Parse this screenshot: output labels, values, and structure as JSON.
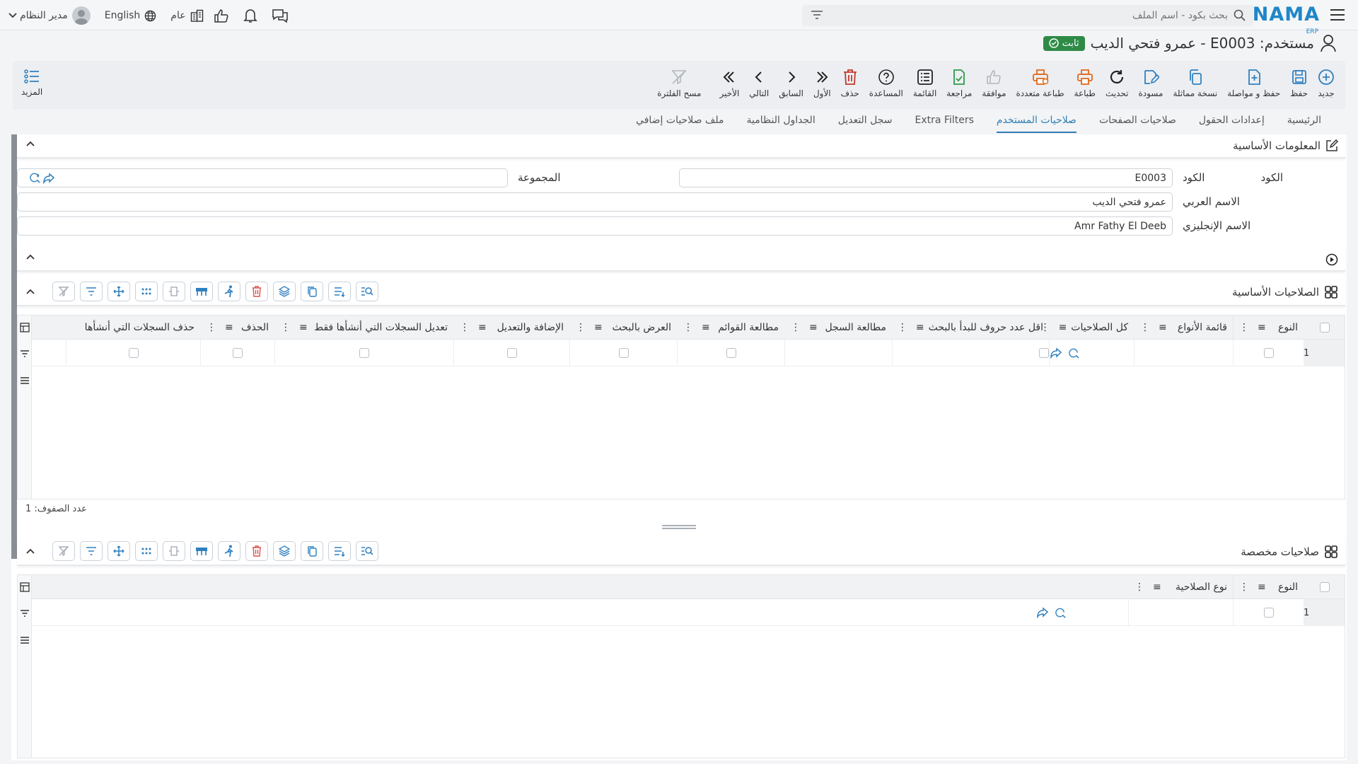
{
  "header": {
    "logo_text": "NAMA",
    "logo_sub": "ERP",
    "search_placeholder": "بحث بكود - اسم الملف",
    "user_name": "مدير النظام",
    "language": "English",
    "scope": "عام"
  },
  "page": {
    "title": "مستخدم: E0003 - عمرو فتحي الديب",
    "status_badge": "ثابت"
  },
  "toolbar": {
    "items": [
      {
        "label": "جديد",
        "icon": "plus-circle-icon"
      },
      {
        "label": "حفظ",
        "icon": "save-icon"
      },
      {
        "label": "حفظ و مواصلة",
        "icon": "save-continue-icon"
      },
      {
        "label": "نسخة مماثلة",
        "icon": "copy-icon"
      },
      {
        "label": "مسودة",
        "icon": "draft-icon"
      },
      {
        "label": "تحديث",
        "icon": "refresh-icon"
      },
      {
        "label": "طباعة",
        "icon": "print-icon"
      },
      {
        "label": "طباعة متعددة",
        "icon": "multi-print-icon"
      },
      {
        "label": "موافقة",
        "icon": "thumbs-up-icon"
      },
      {
        "label": "مراجعة",
        "icon": "review-icon"
      },
      {
        "label": "القائمة",
        "icon": "list-icon"
      },
      {
        "label": "المساعدة",
        "icon": "help-icon"
      },
      {
        "label": "حذف",
        "icon": "trash-icon"
      },
      {
        "label": "الأول",
        "icon": "first-icon"
      },
      {
        "label": "السابق",
        "icon": "prev-icon"
      },
      {
        "label": "التالي",
        "icon": "next-icon"
      },
      {
        "label": "الأخير",
        "icon": "last-icon"
      },
      {
        "label": "مسح الفلترة",
        "icon": "clear-filter-icon"
      }
    ],
    "more_label": "المزيد"
  },
  "tabs": [
    {
      "label": "الرئيسية",
      "active": false
    },
    {
      "label": "إعدادات الحقول",
      "active": false
    },
    {
      "label": "صلاحيات الصفحات",
      "active": false
    },
    {
      "label": "صلاحيات المستخدم",
      "active": true
    },
    {
      "label": "Extra Filters",
      "active": false
    },
    {
      "label": "سجل التعديل",
      "active": false
    },
    {
      "label": "الجداول النظامية",
      "active": false
    },
    {
      "label": "ملف صلاحيات إضافي",
      "active": false
    }
  ],
  "basic_info": {
    "title": "المعلومات الأساسية",
    "code_label": "الكود",
    "code_value": "E0003",
    "group_label": "المجموعة",
    "group_value": "",
    "arabic_name_label": "الاسم العربي",
    "arabic_name_value": "عمرو فتحي الديب",
    "english_name_label": "الاسم الإنجليزي",
    "english_name_value": "Amr Fathy El Deeb"
  },
  "basic_permissions": {
    "title": "الصلاحيات الأساسية",
    "columns": [
      "النوع",
      "قائمة الأنواع",
      "كل الصلاحيات",
      "اقل عدد حروف للبدأ بالبحث",
      "مطالعة السجل",
      "مطالعة القوائم",
      "العرض بالبحث",
      "الإضافة والتعديل",
      "تعديل السجلات التي أنشأها فقط",
      "الحذف",
      "حذف السجلات التي أنشأها"
    ],
    "rows": [
      {
        "num": "1"
      }
    ],
    "row_count": "عدد الصفوف: 1"
  },
  "custom_permissions": {
    "title": "صلاحيات مخصصة",
    "columns": [
      "النوع",
      "نوع الصلاحية"
    ],
    "rows": [
      {
        "num": "1"
      }
    ]
  }
}
